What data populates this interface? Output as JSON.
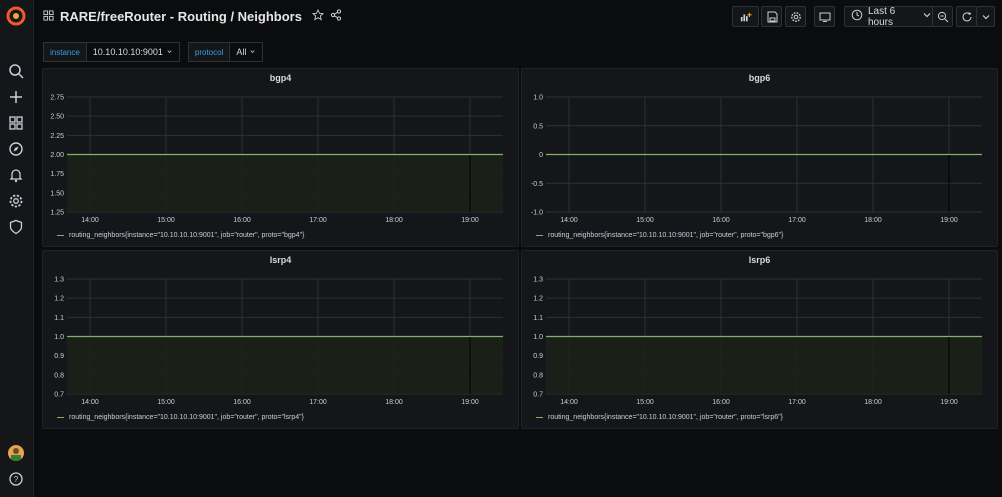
{
  "dashboard": {
    "title": "RARE/freeRouter - Routing / Neighbors"
  },
  "toolbar": {
    "time_range": "Last 6 hours"
  },
  "variables": [
    {
      "label": "instance",
      "value": "10.10.10.10:9001"
    },
    {
      "label": "protocol",
      "value": "All"
    }
  ],
  "sidebar": {
    "items": [
      "search-icon",
      "plus-icon",
      "dashboards-icon",
      "explore-icon",
      "alerting-icon",
      "gear-icon",
      "shield-icon"
    ],
    "help": "help-icon"
  },
  "colors": {
    "series": "#7eb26d",
    "fill": "#1b2118",
    "grid": "#2c3235",
    "accent": "#33a2e5",
    "logo": "#f05a28"
  },
  "chart_data": [
    {
      "type": "line",
      "title": "bgp4",
      "x_ticks": [
        "14:00",
        "15:00",
        "16:00",
        "17:00",
        "18:00",
        "19:00"
      ],
      "y_ticks": [
        "1.25",
        "1.50",
        "1.75",
        "2.00",
        "2.25",
        "2.50",
        "2.75"
      ],
      "ylim": [
        1.25,
        2.75
      ],
      "series": [
        {
          "name": "routing_neighbors{instance=\"10.10.10.10:9001\", job=\"router\", proto=\"bgp4\"}",
          "values": [
            2,
            2
          ]
        }
      ],
      "fill": true
    },
    {
      "type": "line",
      "title": "bgp6",
      "x_ticks": [
        "14:00",
        "15:00",
        "16:00",
        "17:00",
        "18:00",
        "19:00"
      ],
      "y_ticks": [
        "-1.0",
        "-0.5",
        "0",
        "0.5",
        "1.0"
      ],
      "ylim": [
        -1.0,
        1.0
      ],
      "series": [
        {
          "name": "routing_neighbors{instance=\"10.10.10.10:9001\", job=\"router\", proto=\"bgp6\"}",
          "values": [
            0,
            0
          ]
        }
      ],
      "fill": false
    },
    {
      "type": "line",
      "title": "lsrp4",
      "x_ticks": [
        "14:00",
        "15:00",
        "16:00",
        "17:00",
        "18:00",
        "19:00"
      ],
      "y_ticks": [
        "0.7",
        "0.8",
        "0.9",
        "1.0",
        "1.1",
        "1.2",
        "1.3"
      ],
      "ylim": [
        0.7,
        1.3
      ],
      "series": [
        {
          "name": "routing_neighbors{instance=\"10.10.10.10:9001\", job=\"router\", proto=\"lsrp4\"}",
          "values": [
            1,
            1
          ]
        }
      ],
      "fill": true
    },
    {
      "type": "line",
      "title": "lsrp6",
      "x_ticks": [
        "14:00",
        "15:00",
        "16:00",
        "17:00",
        "18:00",
        "19:00"
      ],
      "y_ticks": [
        "0.7",
        "0.8",
        "0.9",
        "1.0",
        "1.1",
        "1.2",
        "1.3"
      ],
      "ylim": [
        0.7,
        1.3
      ],
      "series": [
        {
          "name": "routing_neighbors{instance=\"10.10.10.10:9001\", job=\"router\", proto=\"lsrp6\"}",
          "values": [
            1,
            1
          ]
        }
      ],
      "fill": true
    }
  ]
}
